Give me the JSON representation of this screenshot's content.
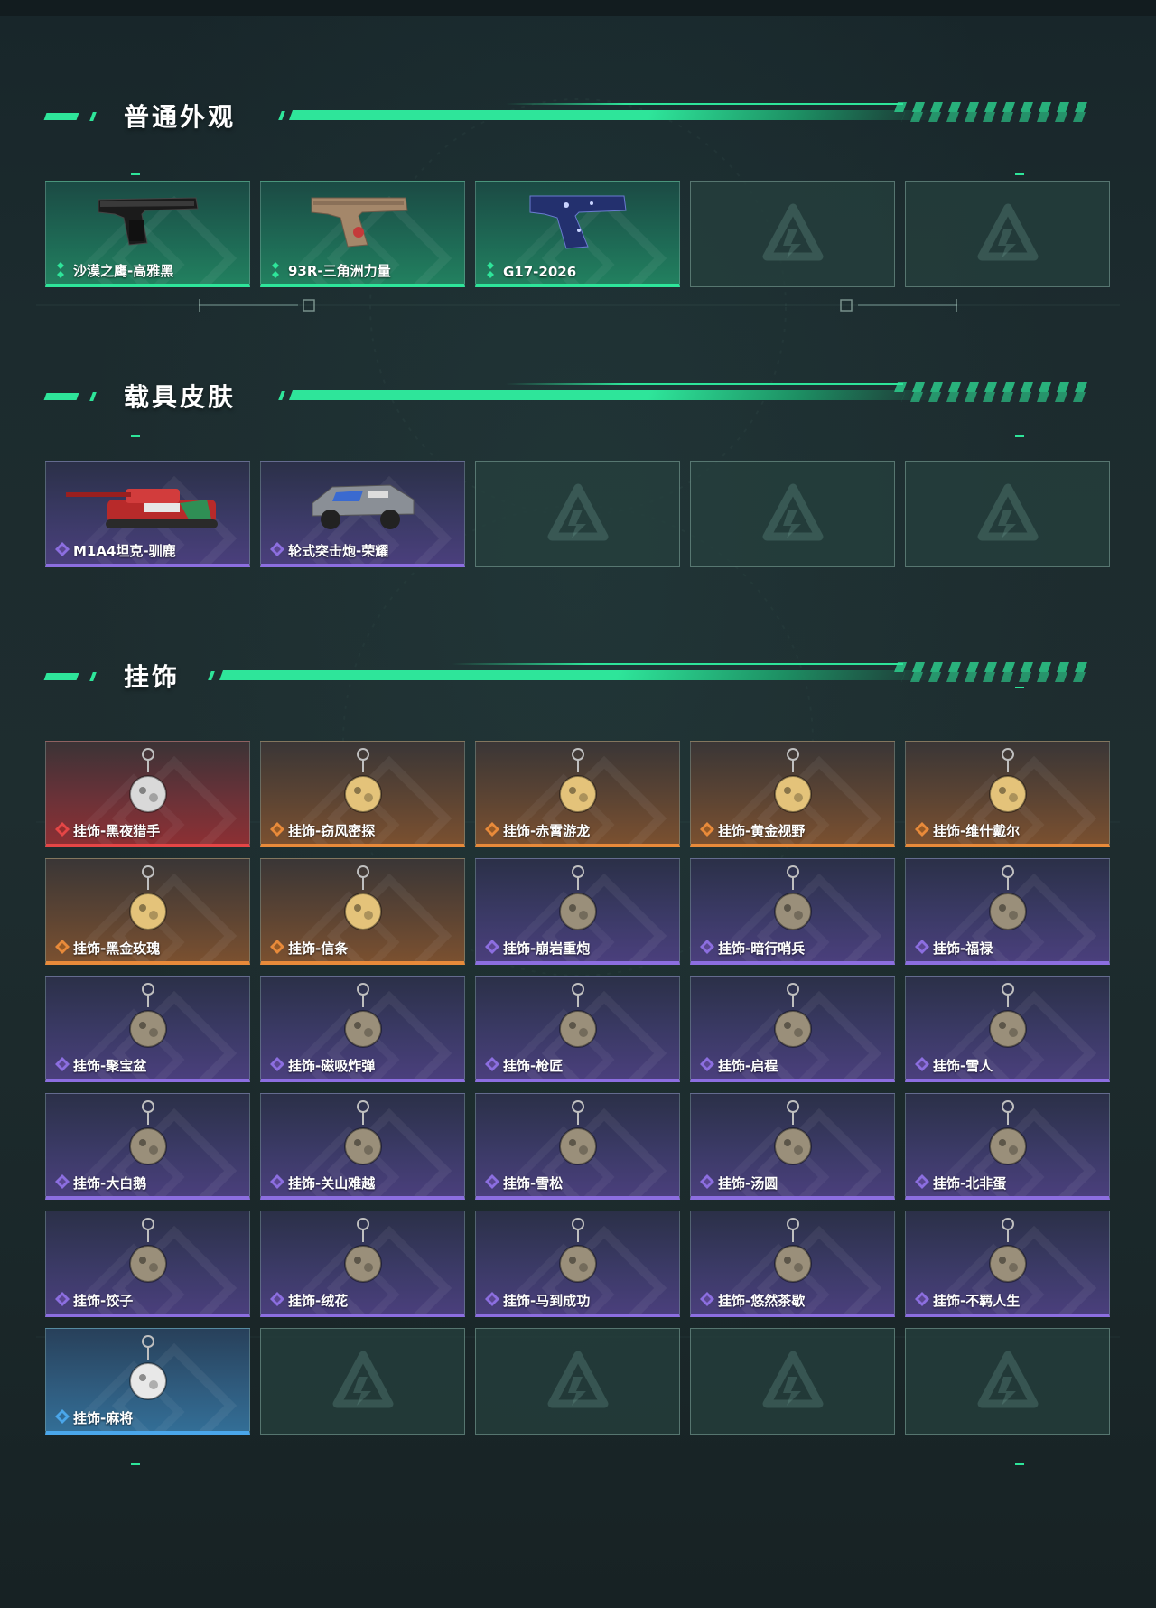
{
  "sections": {
    "normal": {
      "title": "普通外观"
    },
    "vehicle": {
      "title": "载具皮肤"
    },
    "charm": {
      "title": "挂饰"
    }
  },
  "normal_items": [
    {
      "name": "沙漠之鹰-高雅黑",
      "rarity": "green",
      "icon": "pistol-black-icon"
    },
    {
      "name": "93R-三角洲力量",
      "rarity": "green",
      "icon": "pistol-tan-icon"
    },
    {
      "name": "G17-2026",
      "rarity": "green",
      "icon": "pistol-blue-icon"
    }
  ],
  "vehicle_items": [
    {
      "name": "M1A4坦克-驯鹿",
      "rarity": "purple",
      "icon": "tank-icon"
    },
    {
      "name": "轮式突击炮-荣耀",
      "rarity": "purple",
      "icon": "armored-car-icon"
    }
  ],
  "charm_items": [
    {
      "name": "挂饰-黑夜猎手",
      "rarity": "red"
    },
    {
      "name": "挂饰-窃风密探",
      "rarity": "orange"
    },
    {
      "name": "挂饰-赤霄游龙",
      "rarity": "orange"
    },
    {
      "name": "挂饰-黄金视野",
      "rarity": "orange"
    },
    {
      "name": "挂饰-维什戴尔",
      "rarity": "orange"
    },
    {
      "name": "挂饰-黑金玫瑰",
      "rarity": "orange"
    },
    {
      "name": "挂饰-信条",
      "rarity": "orange"
    },
    {
      "name": "挂饰-崩岩重炮",
      "rarity": "purple"
    },
    {
      "name": "挂饰-暗行哨兵",
      "rarity": "purple"
    },
    {
      "name": "挂饰-福禄",
      "rarity": "purple"
    },
    {
      "name": "挂饰-聚宝盆",
      "rarity": "purple"
    },
    {
      "name": "挂饰-磁吸炸弹",
      "rarity": "purple"
    },
    {
      "name": "挂饰-枪匠",
      "rarity": "purple"
    },
    {
      "name": "挂饰-启程",
      "rarity": "purple"
    },
    {
      "name": "挂饰-雪人",
      "rarity": "purple"
    },
    {
      "name": "挂饰-大白鹅",
      "rarity": "purple"
    },
    {
      "name": "挂饰-关山难越",
      "rarity": "purple"
    },
    {
      "name": "挂饰-雪松",
      "rarity": "purple"
    },
    {
      "name": "挂饰-汤圆",
      "rarity": "purple"
    },
    {
      "name": "挂饰-北非蛋",
      "rarity": "purple"
    },
    {
      "name": "挂饰-饺子",
      "rarity": "purple"
    },
    {
      "name": "挂饰-绒花",
      "rarity": "purple"
    },
    {
      "name": "挂饰-马到成功",
      "rarity": "purple"
    },
    {
      "name": "挂饰-悠然茶歇",
      "rarity": "purple"
    },
    {
      "name": "挂饰-不羁人生",
      "rarity": "purple"
    },
    {
      "name": "挂饰-麻将",
      "rarity": "blue"
    }
  ],
  "colors": {
    "accent": "#2ee59a",
    "green": "#2ee59a",
    "purple": "#8c6ee0",
    "orange": "#e88a3a",
    "red": "#e54646",
    "blue": "#4aa6ea"
  }
}
